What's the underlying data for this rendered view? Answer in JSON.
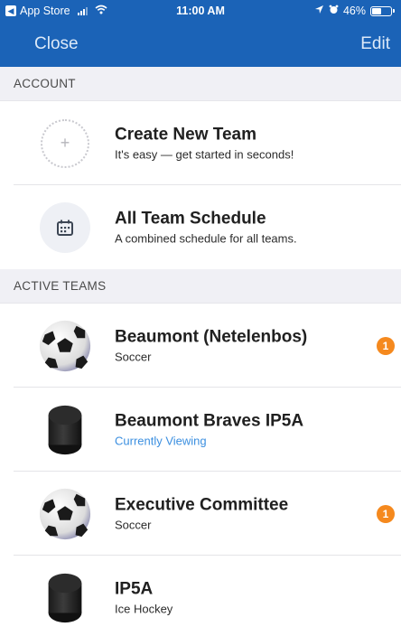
{
  "status_bar": {
    "carrier": "App Store",
    "time": "11:00 AM",
    "battery": "46%",
    "battery_level": 0.46
  },
  "nav": {
    "close_label": "Close",
    "edit_label": "Edit"
  },
  "sections": {
    "account_header": "ACCOUNT",
    "active_teams_header": "ACTIVE TEAMS"
  },
  "account": {
    "create": {
      "title": "Create New Team",
      "subtitle": "It's easy — get started in seconds!"
    },
    "schedule": {
      "title": "All Team Schedule",
      "subtitle": "A combined schedule for all teams."
    }
  },
  "teams": [
    {
      "name": "Beaumont (Netelenbos)",
      "subtitle": "Soccer",
      "sport_icon": "soccer-ball-icon",
      "badge": "1"
    },
    {
      "name": "Beaumont Braves IP5A",
      "subtitle": "Currently Viewing",
      "sport_icon": "hockey-puck-icon"
    },
    {
      "name": "Executive Committee",
      "subtitle": "Soccer",
      "sport_icon": "soccer-ball-icon",
      "badge": "1"
    },
    {
      "name": "IP5A",
      "subtitle": "Ice Hockey",
      "sport_icon": "hockey-puck-icon"
    }
  ],
  "colors": {
    "nav_bar": "#1b63b7",
    "badge": "#f5891e",
    "viewing_link": "#3b8fe0",
    "section_bg": "#f0f0f5"
  }
}
